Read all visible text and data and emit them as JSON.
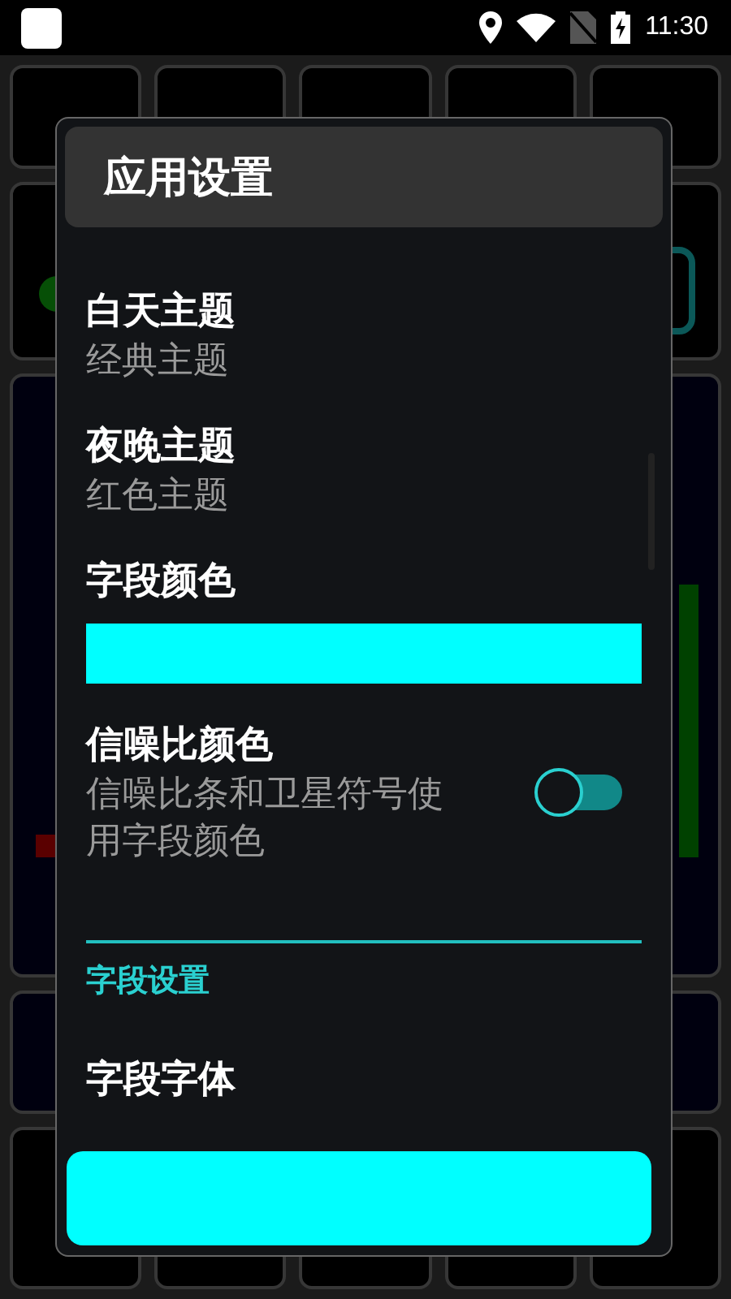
{
  "status_bar": {
    "time": "11:30"
  },
  "dialog": {
    "title": "应用设置",
    "items": [
      {
        "kind": "text",
        "title": "白天主题",
        "summary": "经典主题"
      },
      {
        "kind": "text",
        "title": "夜晚主题",
        "summary": "红色主题"
      },
      {
        "kind": "color",
        "title": "字段颜色",
        "color": "#00ffff"
      },
      {
        "kind": "switch",
        "title": "信噪比颜色",
        "summary": "信噪比条和卫星符号使用字段颜色",
        "on": false
      },
      {
        "kind": "category",
        "title": "字段设置"
      },
      {
        "kind": "text",
        "title": "字段字体"
      }
    ]
  }
}
